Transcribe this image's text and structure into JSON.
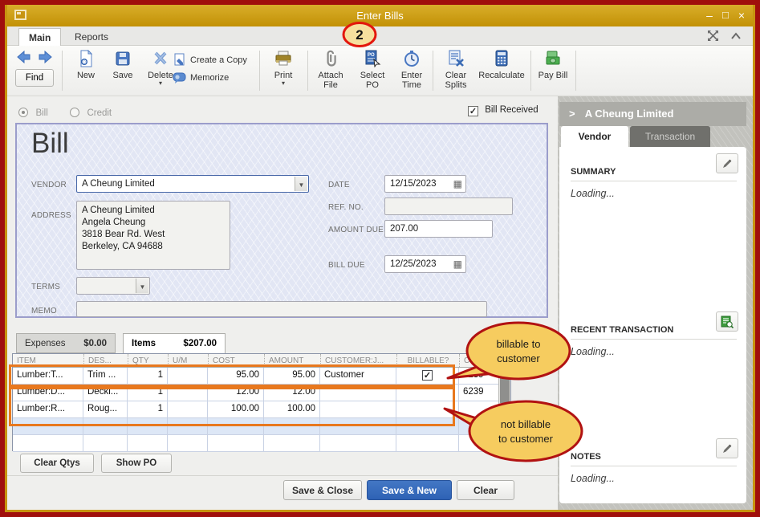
{
  "window": {
    "title": "Enter Bills"
  },
  "ribbon": {
    "tabs": [
      "Main",
      "Reports"
    ]
  },
  "toolbar": {
    "find": "Find",
    "new": "New",
    "save": "Save",
    "delete": "Delete",
    "create_copy": "Create a Copy",
    "memorize": "Memorize",
    "print": "Print",
    "attach_file": "Attach File",
    "select_po": "Select PO",
    "enter_time": "Enter Time",
    "clear_splits": "Clear Splits",
    "recalculate": "Recalculate",
    "pay_bill": "Pay Bill"
  },
  "bill_header": {
    "type_bill": "Bill",
    "type_credit": "Credit",
    "bill_received_label": "Bill Received",
    "form_title": "Bill",
    "vendor_label": "VENDOR",
    "vendor_value": "A Cheung Limited",
    "date_label": "DATE",
    "date_value": "12/15/2023",
    "address_label": "ADDRESS",
    "address_lines": [
      "A Cheung Limited",
      "Angela Cheung",
      "3818 Bear Rd. West",
      "Berkeley, CA 94688"
    ],
    "ref_no_label": "REF. NO.",
    "ref_no_value": "",
    "amount_due_label": "AMOUNT DUE",
    "amount_due_value": "207.00",
    "bill_due_label": "BILL DUE",
    "bill_due_value": "12/25/2023",
    "terms_label": "TERMS",
    "terms_value": "",
    "memo_label": "MEMO",
    "memo_value": ""
  },
  "tabs": {
    "expenses_label": "Expenses",
    "expenses_amount": "$0.00",
    "items_label": "Items",
    "items_amount": "$207.00"
  },
  "items_table": {
    "columns": [
      "ITEM",
      "DES...",
      "QTY",
      "U/M",
      "COST",
      "AMOUNT",
      "CUSTOMER:J...",
      "BILLABLE?",
      "C..."
    ],
    "rows": [
      {
        "item": "Lumber:T...",
        "desc": "Trim ...",
        "qty": "1",
        "um": "",
        "cost": "95.00",
        "amount": "95.00",
        "customer": "Customer",
        "billable": "checked",
        "cls": "6239"
      },
      {
        "item": "Lumber:D...",
        "desc": "Decki...",
        "qty": "1",
        "um": "",
        "cost": "12.00",
        "amount": "12.00",
        "customer": "",
        "billable": "",
        "cls": "6239"
      },
      {
        "item": "Lumber:R...",
        "desc": "Roug...",
        "qty": "1",
        "um": "",
        "cost": "100.00",
        "amount": "100.00",
        "customer": "",
        "billable": "",
        "cls": ""
      }
    ]
  },
  "table_buttons": {
    "clear_qtys": "Clear Qtys",
    "show_po": "Show PO"
  },
  "footer": {
    "save_close": "Save & Close",
    "save_new": "Save & New",
    "clear": "Clear"
  },
  "side_panel": {
    "title": "A Cheung Limited",
    "tabs": {
      "vendor": "Vendor",
      "transaction": "Transaction"
    },
    "summary_label": "SUMMARY",
    "summary_value": "Loading...",
    "recent_label": "RECENT TRANSACTION",
    "recent_value": "Loading...",
    "notes_label": "NOTES",
    "notes_value": "Loading..."
  },
  "annotations": {
    "step_number": "2",
    "callout_billable_lines": [
      "billable to",
      "customer"
    ],
    "callout_not_billable_lines": [
      "not billable",
      "to customer"
    ],
    "colors": {
      "titlebar_gold": "#C79410",
      "frame_red": "#A00F0C",
      "highlight_orange": "#E8781E",
      "callout_fill": "#F6CC5F",
      "callout_border": "#B11212",
      "primary_button_blue": "#2E62B5"
    }
  }
}
